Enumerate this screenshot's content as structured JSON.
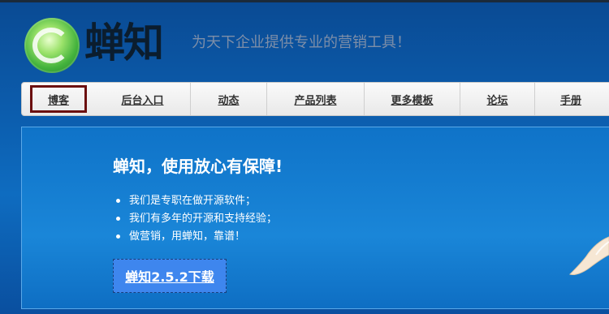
{
  "header": {
    "brand_name": "蝉知",
    "slogan": "为天下企业提供专业的营销工具！"
  },
  "nav": {
    "items": [
      {
        "label": "博客",
        "active": true
      },
      {
        "label": "后台入口"
      },
      {
        "label": "动态"
      },
      {
        "label": "产品列表"
      },
      {
        "label": "更多模板"
      },
      {
        "label": "论坛"
      },
      {
        "label": "手册"
      }
    ]
  },
  "hero": {
    "title": "蝉知，使用放心有保障!",
    "bullets": [
      "我们是专职在做开源软件；",
      "我们有多年的开源和支持经验；",
      "做营销，用蝉知，靠谱！"
    ],
    "download_label": "蝉知2.5.2下载"
  },
  "colors": {
    "background": "#0c5fb0",
    "nav_active_border": "#6b0f0f",
    "button": "#3e86ee"
  }
}
